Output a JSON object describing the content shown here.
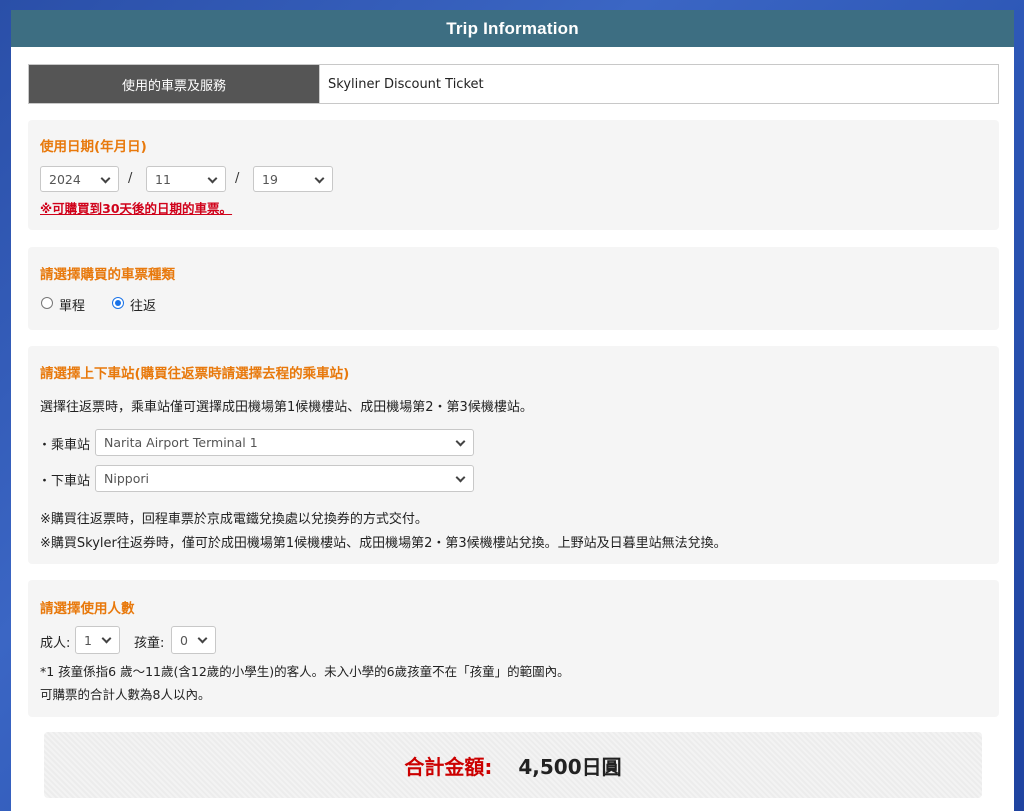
{
  "header": {
    "title": "Trip Information"
  },
  "ticket": {
    "label": "使用的車票及服務",
    "value": "Skyliner Discount Ticket"
  },
  "date_section": {
    "title": "使用日期(年月日)",
    "year": "2024",
    "month": "11",
    "day": "19",
    "separator": "/",
    "note": "※可購買到30天後的日期的車票。"
  },
  "type_section": {
    "title": "請選擇購買的車票種類",
    "options": [
      {
        "label": "單程",
        "selected": false
      },
      {
        "label": "往返",
        "selected": true
      }
    ]
  },
  "station_section": {
    "title": "請選擇上下車站(購買往返票時請選擇去程的乘車站)",
    "description": "選擇往返票時，乘車站僅可選擇成田機場第1候機樓站、成田機場第2・第3候機樓站。",
    "boarding_label": "・乘車站",
    "boarding_value": "Narita Airport Terminal 1",
    "alighting_label": "・下車站",
    "alighting_value": "Nippori",
    "note1": "※購買往返票時，回程車票於京成電鐵兌換處以兌換券的方式交付。",
    "note2": "※購買Skyler往返券時，僅可於成田機場第1候機樓站、成田機場第2・第3候機樓站兌換。上野站及日暮里站無法兌換。"
  },
  "people_section": {
    "title": "請選擇使用人數",
    "adult_label": "成人:",
    "adult_value": "1",
    "child_label": "孩童:",
    "child_value": "0",
    "note1": "*1 孩童係指6 歲～11歲(含12歲的小學生)的客人。未入小學的6歲孩童不在「孩童」的範圍內。",
    "note2": "可購票的合計人數為8人以內。"
  },
  "total": {
    "label": "合計金額:",
    "value": "4,500日圓"
  },
  "colors": {
    "header_bg": "#3d6e82",
    "accent_orange": "#e8790c",
    "total_red": "#cc0000",
    "note_red": "#d0021b"
  }
}
